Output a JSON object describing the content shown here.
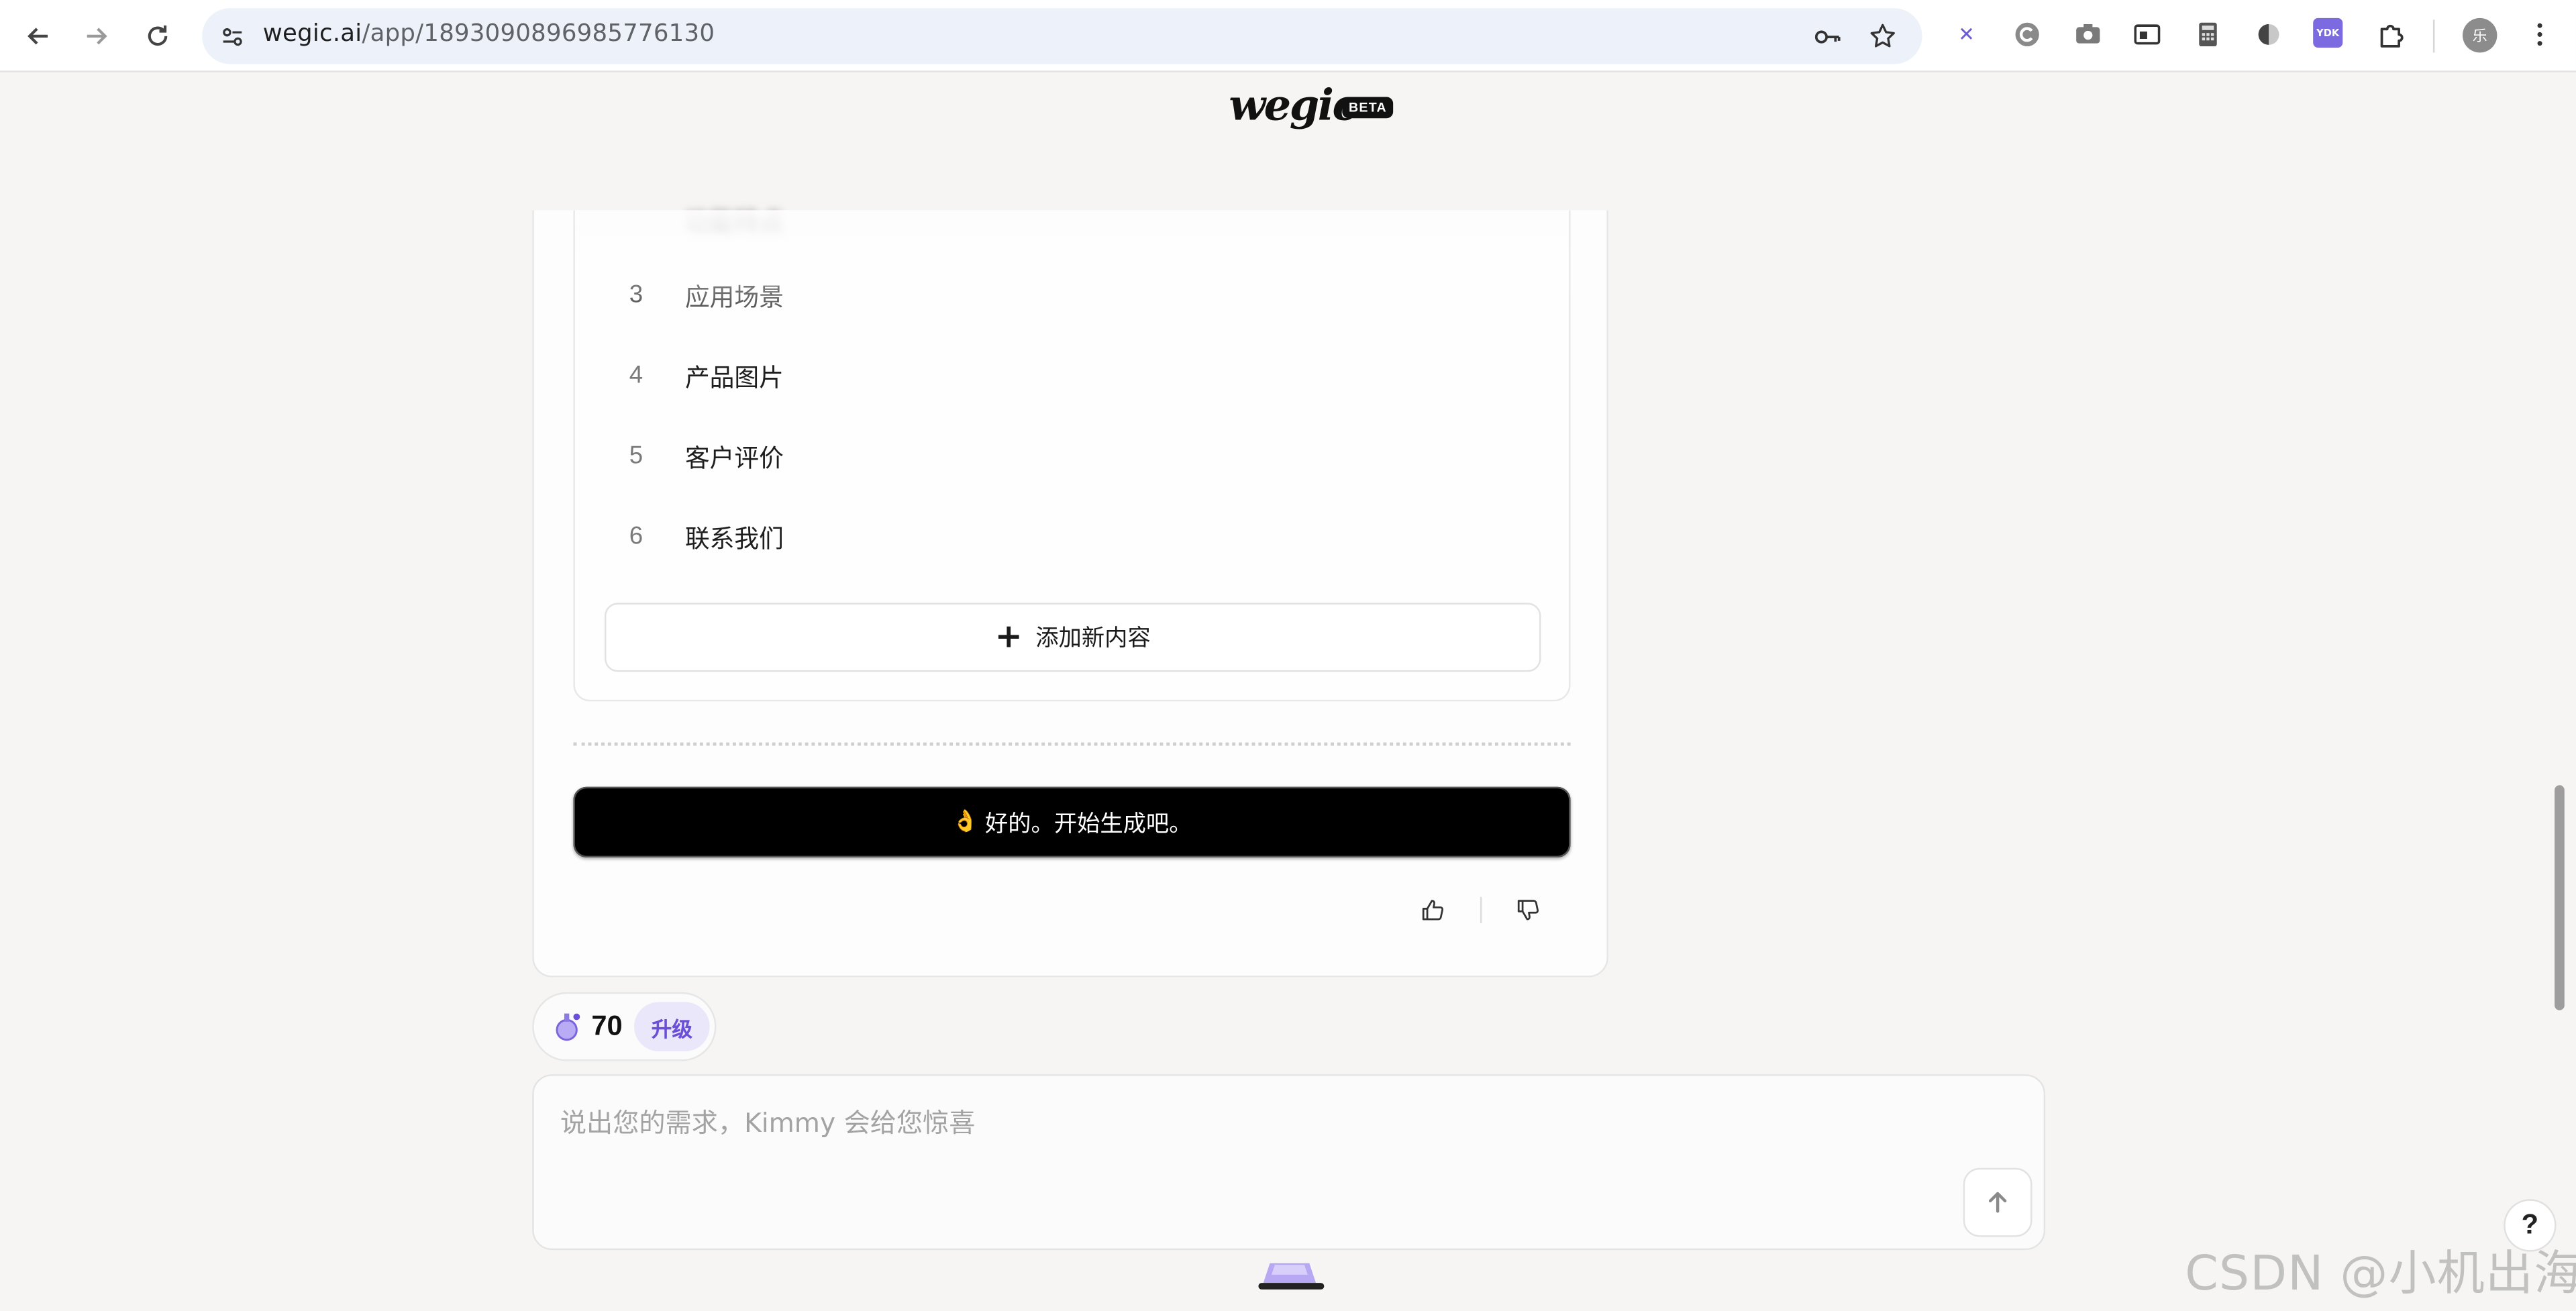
{
  "browser": {
    "url_host": "wegic.ai",
    "url_path": "/app/1893090896985776130",
    "profile_initial": "乐",
    "extensions": [
      "x-icon",
      "grammarly-icon",
      "camera-icon",
      "cast-icon",
      "calculator-icon",
      "theme-icon",
      "ydk-icon",
      "puzzle-icon"
    ],
    "ydk_label": "YDK"
  },
  "logo": {
    "text": "wegic",
    "badge": "BETA"
  },
  "sections": {
    "faded_label": "功能特点",
    "items": [
      {
        "num": "3",
        "label": "应用场景"
      },
      {
        "num": "4",
        "label": "产品图片"
      },
      {
        "num": "5",
        "label": "客户评价"
      },
      {
        "num": "6",
        "label": "联系我们"
      }
    ],
    "add_label": "添加新内容"
  },
  "confirm": {
    "hand": "👌",
    "label": "好的。开始生成吧。"
  },
  "credits": {
    "count": "70",
    "upgrade_label": "升级"
  },
  "composer": {
    "placeholder": "说出您的需求，Kimmy 会给您惊喜"
  },
  "help_label": "?",
  "watermark": "CSDN @小机出海",
  "colors": {
    "accent": "#6c4fd8",
    "upgrade_bg": "#ebe7fb",
    "confirm_bg": "#000000",
    "page_bg": "#f6f5f3"
  }
}
